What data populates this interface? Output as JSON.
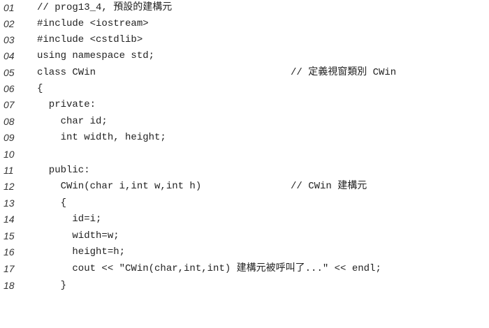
{
  "code_listing": {
    "lines": [
      {
        "number": "01",
        "code": "// prog13_4, 預設的建構元",
        "comment": ""
      },
      {
        "number": "02",
        "code": "#include <iostream>",
        "comment": ""
      },
      {
        "number": "03",
        "code": "#include <cstdlib>",
        "comment": ""
      },
      {
        "number": "04",
        "code": "using namespace std;",
        "comment": ""
      },
      {
        "number": "05",
        "code": "class CWin",
        "comment": "// 定義視窗類別 CWin"
      },
      {
        "number": "06",
        "code": "{",
        "comment": ""
      },
      {
        "number": "07",
        "code": "  private:",
        "comment": ""
      },
      {
        "number": "08",
        "code": "    char id;",
        "comment": ""
      },
      {
        "number": "09",
        "code": "    int width, height;",
        "comment": ""
      },
      {
        "number": "10",
        "code": "",
        "comment": ""
      },
      {
        "number": "11",
        "code": "  public:",
        "comment": ""
      },
      {
        "number": "12",
        "code": "    CWin(char i,int w,int h)",
        "comment": "// CWin 建構元"
      },
      {
        "number": "13",
        "code": "    {",
        "comment": ""
      },
      {
        "number": "14",
        "code": "      id=i;",
        "comment": ""
      },
      {
        "number": "15",
        "code": "      width=w;",
        "comment": ""
      },
      {
        "number": "16",
        "code": "      height=h;",
        "comment": ""
      },
      {
        "number": "17",
        "code": "      cout << \"CWin(char,int,int) 建構元被呼叫了...\" << endl;",
        "comment": ""
      },
      {
        "number": "18",
        "code": "    }",
        "comment": ""
      }
    ]
  }
}
